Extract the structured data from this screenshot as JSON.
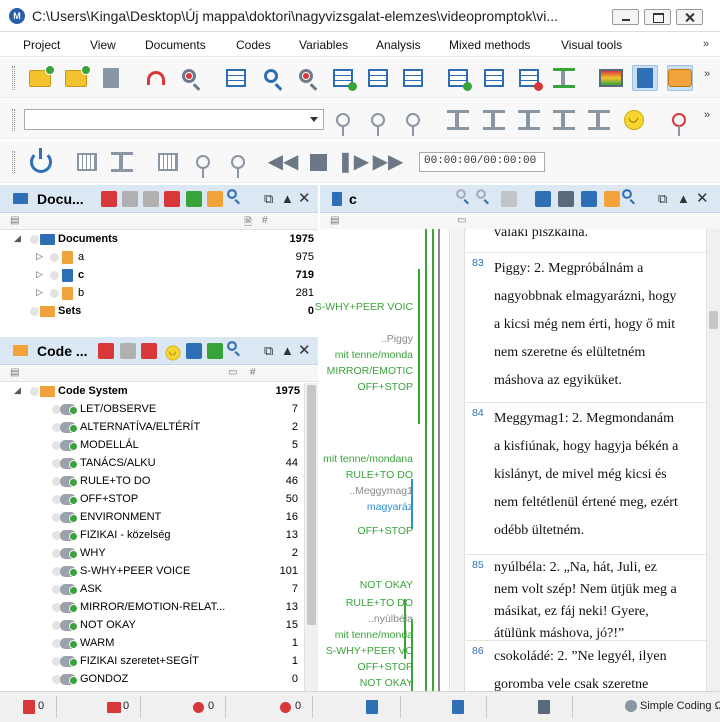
{
  "window": {
    "title": "C:\\Users\\Kinga\\Desktop\\Új mappa\\doktori\\nagyvizsgalat-elemzes\\videopromptok\\vi..."
  },
  "menu": [
    "Project",
    "View",
    "Documents",
    "Codes",
    "Variables",
    "Analysis",
    "Mixed methods",
    "Visual tools"
  ],
  "toolbar": {
    "overflow": "»",
    "dropdown_value": "",
    "time": "00:00:00/00:00:00"
  },
  "documents_panel": {
    "title": "Docu...",
    "col_doc": "🗎",
    "col_num": "#",
    "items": [
      {
        "label": "Documents",
        "count": "1975"
      },
      {
        "label": "a",
        "count": "975"
      },
      {
        "label": "c",
        "count": "719"
      },
      {
        "label": "b",
        "count": "281"
      },
      {
        "label": "Sets",
        "count": "0"
      }
    ]
  },
  "code_panel": {
    "title": "Code ...",
    "col_num": "#",
    "root": {
      "label": "Code System",
      "count": "1975"
    },
    "codes": [
      {
        "label": "LET/OBSERVE",
        "count": "7"
      },
      {
        "label": "ALTERNATÍVA/ELTÉRÍT",
        "count": "2"
      },
      {
        "label": "MODELLÁL",
        "count": "5"
      },
      {
        "label": "TANÁCS/ALKU",
        "count": "44"
      },
      {
        "label": "RULE+TO DO",
        "count": "46"
      },
      {
        "label": "OFF+STOP",
        "count": "50"
      },
      {
        "label": "ENVIRONMENT",
        "count": "16"
      },
      {
        "label": "FIZIKAI - közelség",
        "count": "13"
      },
      {
        "label": "WHY",
        "count": "2"
      },
      {
        "label": "S-WHY+PEER VOICE",
        "count": "101"
      },
      {
        "label": "ASK",
        "count": "7"
      },
      {
        "label": "MIRROR/EMOTION-RELAT...",
        "count": "13"
      },
      {
        "label": "NOT OKAY",
        "count": "15"
      },
      {
        "label": "WARM",
        "count": "1"
      },
      {
        "label": "FIZIKAI szeretet+SEGÍT",
        "count": "1"
      },
      {
        "label": "GONDOZ",
        "count": "0"
      }
    ]
  },
  "browser": {
    "title": "c",
    "stripe_labels": [
      {
        "text": "S-WHY+PEER VOIC",
        "style": "green"
      },
      {
        "text": "..Piggy",
        "style": "grey"
      },
      {
        "text": "mit tenne/monda",
        "style": "green"
      },
      {
        "text": "MIRROR/EMOTIC",
        "style": "green"
      },
      {
        "text": "OFF+STOP",
        "style": "green"
      },
      {
        "text": "mit tenne/mondana",
        "style": "green"
      },
      {
        "text": "RULE+TO DO",
        "style": "green"
      },
      {
        "text": "..Meggymag1",
        "style": "grey"
      },
      {
        "text": "magyaráz",
        "style": "blue"
      },
      {
        "text": "OFF+STOP",
        "style": "green"
      },
      {
        "text": "NOT OKAY",
        "style": "green"
      },
      {
        "text": "RULE+TO DO",
        "style": "green"
      },
      {
        "text": "..nyúlbéla",
        "style": "grey"
      },
      {
        "text": "mit tenne/monda",
        "style": "green"
      },
      {
        "text": "S-WHY+PEER VC",
        "style": "green"
      },
      {
        "text": "OFF+STOP",
        "style": "green"
      },
      {
        "text": "NOT OKAY",
        "style": "green"
      }
    ],
    "paragraphs": [
      {
        "num": "",
        "lines": [
          "valaki piszkálná."
        ]
      },
      {
        "num": "83",
        "lines": [
          "Piggy: 2.  Megpróbálnám a",
          "nagyobbnak elmagyarázni, hogy",
          "a kicsi még nem érti, hogy ő mit",
          "nem szeretne és elültetném",
          "máshova az egyiküket."
        ]
      },
      {
        "num": "84",
        "lines": [
          "Meggymag1: 2.  Megmondanám",
          "a kisfiúnak, hogy hagyja békén a",
          "kislányt, de mivel még kicsi és",
          "nem feltétlenül értené meg, ezért",
          "odébb ültetném."
        ]
      },
      {
        "num": "85",
        "lines": [
          "nyúlbéla: 2.  „Na, hát, Juli, ez",
          "nem volt szép! Nem ütjük meg a",
          "másikat, ez fáj neki! Gyere,",
          "átülünk máshova, jó?!”"
        ]
      },
      {
        "num": "86",
        "lines": [
          "csokoládé: 2.  ”Ne legyél, ilyen",
          "goromba vele csak szeretne"
        ]
      }
    ]
  },
  "status": {
    "docs": "0",
    "codes": "0",
    "links": "0",
    "memos": "0",
    "mode": "Simple Coding Ω"
  },
  "colors": {
    "panel_header": "#dbe7f3",
    "code_green": "#3aa33a",
    "doc_blue": "#2f6fb6"
  }
}
